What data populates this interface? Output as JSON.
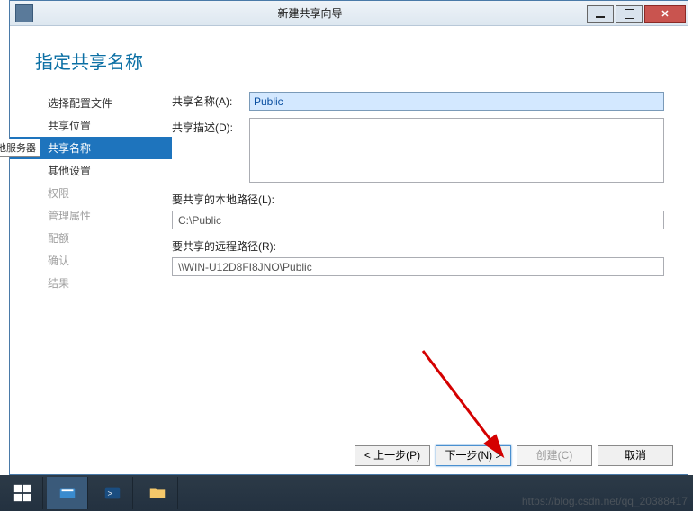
{
  "window": {
    "title": "新建共享向导"
  },
  "page": {
    "heading": "指定共享名称"
  },
  "tooltip": "地服务器",
  "sidebar": {
    "items": [
      {
        "label": "选择配置文件",
        "state": "normal"
      },
      {
        "label": "共享位置",
        "state": "normal"
      },
      {
        "label": "共享名称",
        "state": "active"
      },
      {
        "label": "其他设置",
        "state": "normal"
      },
      {
        "label": "权限",
        "state": "disabled"
      },
      {
        "label": "管理属性",
        "state": "disabled"
      },
      {
        "label": "配额",
        "state": "disabled"
      },
      {
        "label": "确认",
        "state": "disabled"
      },
      {
        "label": "结果",
        "state": "disabled"
      }
    ]
  },
  "form": {
    "share_name_label": "共享名称(A):",
    "share_name_value": "Public",
    "share_desc_label": "共享描述(D):",
    "share_desc_value": "",
    "local_path_label": "要共享的本地路径(L):",
    "local_path_value": "C:\\Public",
    "remote_path_label": "要共享的远程路径(R):",
    "remote_path_value": "\\\\WIN-U12D8FI8JNO\\Public"
  },
  "buttons": {
    "previous": "< 上一步(P)",
    "next": "下一步(N) >",
    "create": "创建(C)",
    "cancel": "取消"
  },
  "watermark": "https://blog.csdn.net/qq_20388417"
}
